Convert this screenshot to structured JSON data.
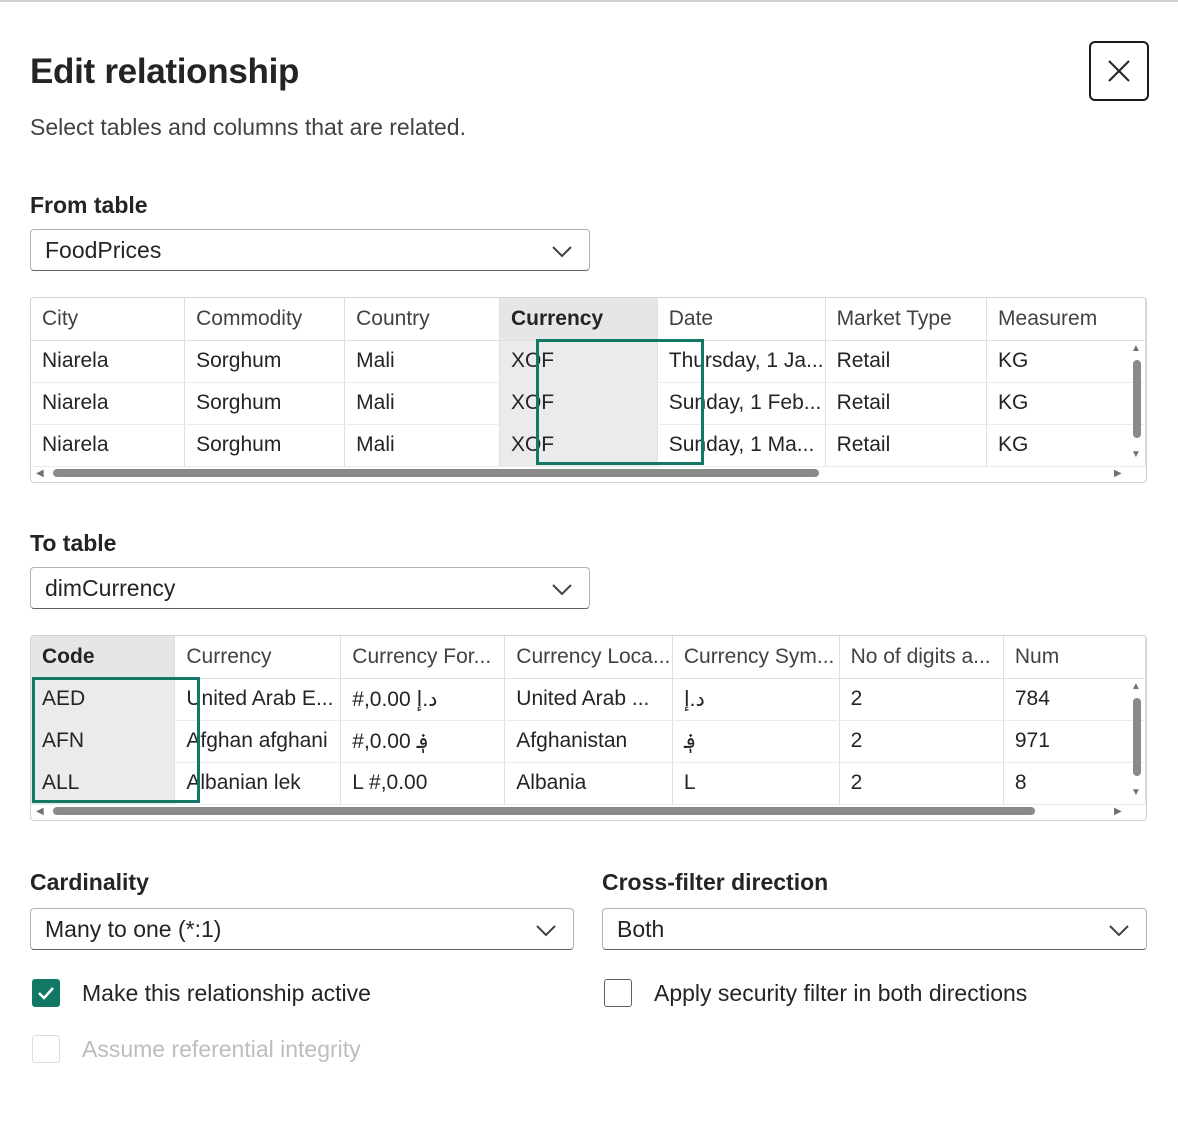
{
  "dialog": {
    "title": "Edit relationship",
    "subtitle": "Select tables and columns that are related."
  },
  "from_table": {
    "label": "From table",
    "selected": "FoodPrices",
    "columns": [
      "City",
      "Commodity",
      "Country",
      "Currency",
      "Date",
      "Market Type",
      "Measurem"
    ],
    "selected_column": "Currency",
    "rows": [
      [
        "Niarela",
        "Sorghum",
        "Mali",
        "XOF",
        "Thursday, 1 Ja...",
        "Retail",
        "KG"
      ],
      [
        "Niarela",
        "Sorghum",
        "Mali",
        "XOF",
        "Sunday, 1 Feb...",
        "Retail",
        "KG"
      ],
      [
        "Niarela",
        "Sorghum",
        "Mali",
        "XOF",
        "Sunday, 1 Ma...",
        "Retail",
        "KG"
      ]
    ]
  },
  "to_table": {
    "label": "To table",
    "selected": "dimCurrency",
    "columns": [
      "Code",
      "Currency",
      "Currency For...",
      "Currency Loca...",
      "Currency Sym...",
      "No of digits a...",
      "Num"
    ],
    "selected_column": "Code",
    "rows": [
      [
        "AED",
        "United Arab E...",
        "#,0.00 د.إ",
        "United Arab ...",
        "د.إ",
        "2",
        "784"
      ],
      [
        "AFN",
        "Afghan afghani",
        "#,0.00 ؋",
        "Afghanistan",
        "؋",
        "2",
        "971"
      ],
      [
        "ALL",
        "Albanian lek",
        "L #,0.00",
        "Albania",
        "L",
        "2",
        "8"
      ]
    ]
  },
  "cardinality": {
    "label": "Cardinality",
    "selected": "Many to one (*:1)"
  },
  "cross_filter": {
    "label": "Cross-filter direction",
    "selected": "Both"
  },
  "options": {
    "active_label": "Make this relationship active",
    "active_checked": true,
    "security_label": "Apply security filter in both directions",
    "security_checked": false,
    "integrity_label": "Assume referential integrity",
    "integrity_checked": false,
    "integrity_disabled": true
  },
  "colors": {
    "accent": "#117865",
    "selected_column_bg": "#ebebeb"
  },
  "icons": {
    "close": "close-icon",
    "dropdown": "chevron-down-icon",
    "check": "checkmark-icon"
  }
}
